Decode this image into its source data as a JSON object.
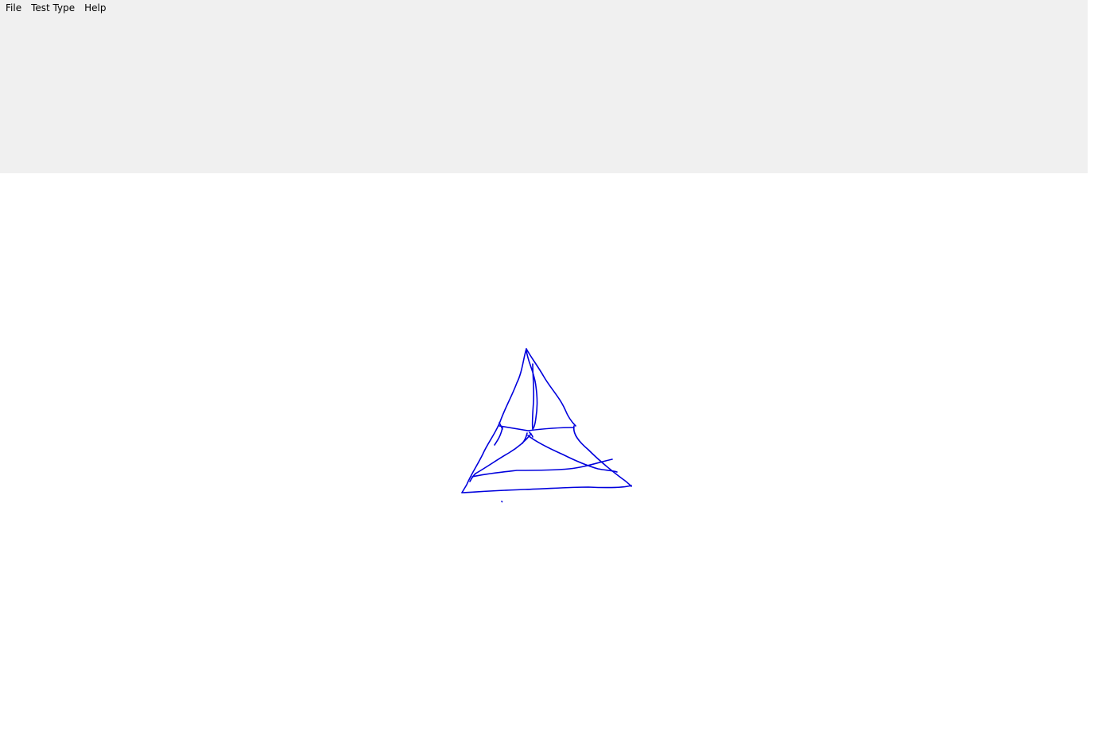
{
  "menu": {
    "items": [
      "File",
      "Test Type",
      "Help"
    ]
  },
  "colors": {
    "panel_bg": "#f0f0f0",
    "canvas_bg": "#ffffff",
    "ink": "#0000dd"
  }
}
